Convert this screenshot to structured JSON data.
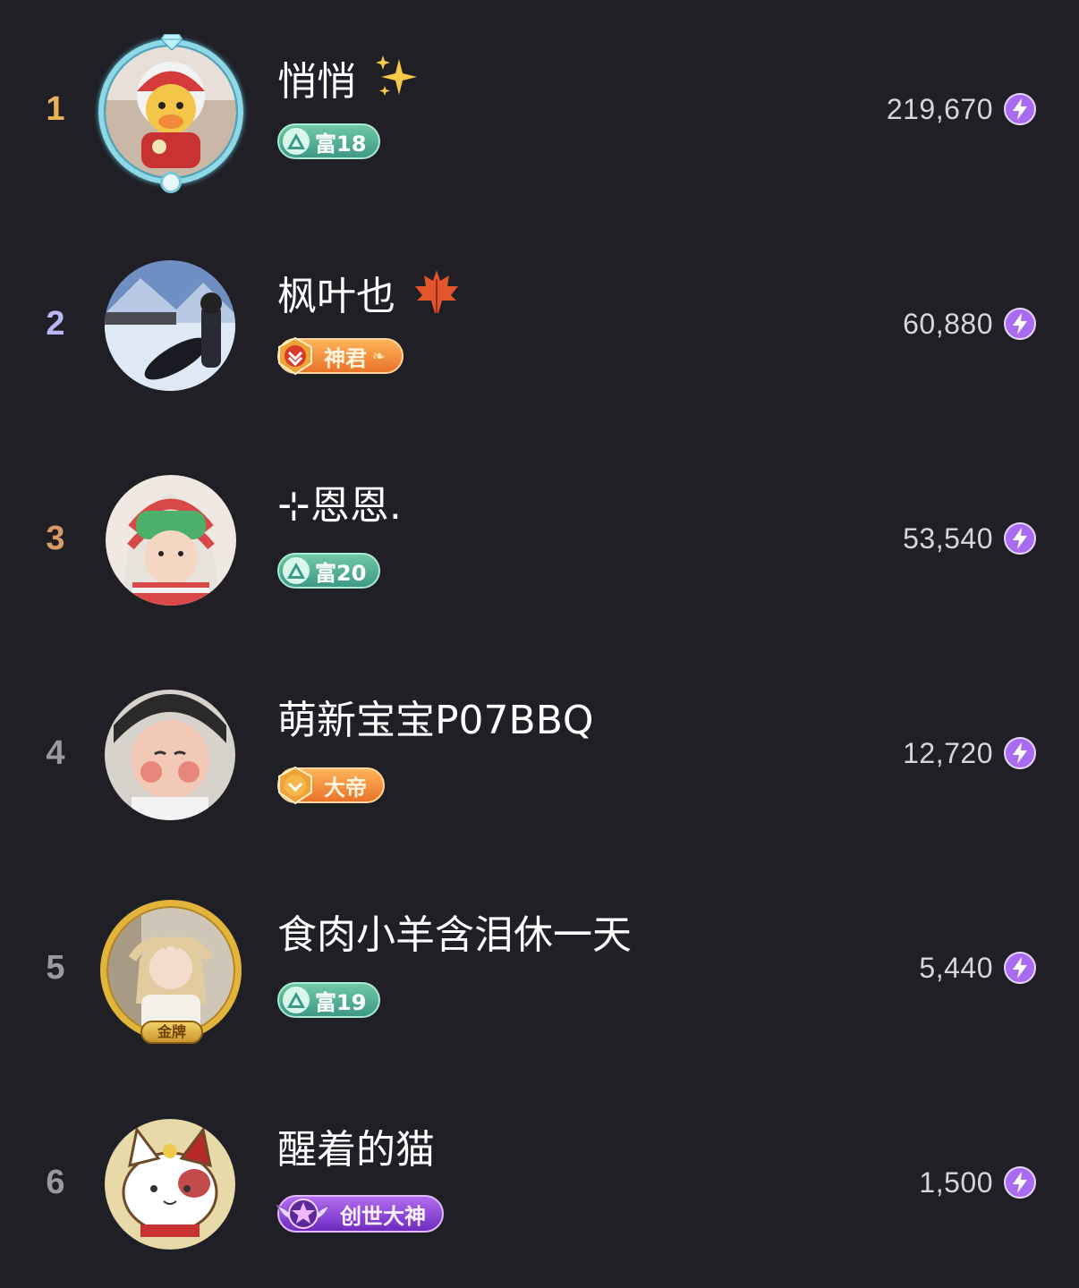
{
  "colors": {
    "background": "#201f26",
    "rank_gold": "#e9b35a",
    "rank_silver": "#b9b7f4",
    "rank_bronze": "#d99a66",
    "rank_default": "#9a99a2",
    "score_text": "#d6d4dc"
  },
  "leaderboard": [
    {
      "rank": "1",
      "rank_color": "#e9b35a",
      "name": "悄悄",
      "name_emoji": "sparkles-emoji",
      "badge_type": "rich",
      "badge_label": "富18",
      "score": "219,670",
      "avatar": "lion-dance-duck-avatar",
      "frame": "diamond"
    },
    {
      "rank": "2",
      "rank_color": "#b9b7f4",
      "name": "枫叶也",
      "name_emoji": "maple-leaf-emoji",
      "badge_type": "orange",
      "badge_label": "神君",
      "score": "60,880",
      "avatar": "snowboarder-avatar",
      "frame": "none"
    },
    {
      "rank": "3",
      "rank_color": "#d99a66",
      "name": "⊹恩恩.",
      "name_emoji": "",
      "badge_type": "rich",
      "badge_label": "富20",
      "score": "53,540",
      "avatar": "baby-in-striped-hat-avatar",
      "frame": "none"
    },
    {
      "rank": "4",
      "rank_color": "#9a99a2",
      "name": "萌新宝宝P07BBQ",
      "name_emoji": "",
      "badge_type": "orange",
      "badge_label": "大帝",
      "score": "12,720",
      "avatar": "baby-face-avatar",
      "frame": "none"
    },
    {
      "rank": "5",
      "rank_color": "#9a99a2",
      "name": "食肉小羊含泪休一天",
      "name_emoji": "",
      "badge_type": "rich",
      "badge_label": "富19",
      "score": "5,440",
      "avatar": "girl-portrait-avatar",
      "frame": "gold",
      "frame_label": "金牌"
    },
    {
      "rank": "6",
      "rank_color": "#9a99a2",
      "name": "醒着的猫",
      "name_emoji": "",
      "badge_type": "purple",
      "badge_label": "创世大神",
      "score": "1,500",
      "avatar": "lucky-cat-avatar",
      "frame": "none"
    }
  ]
}
